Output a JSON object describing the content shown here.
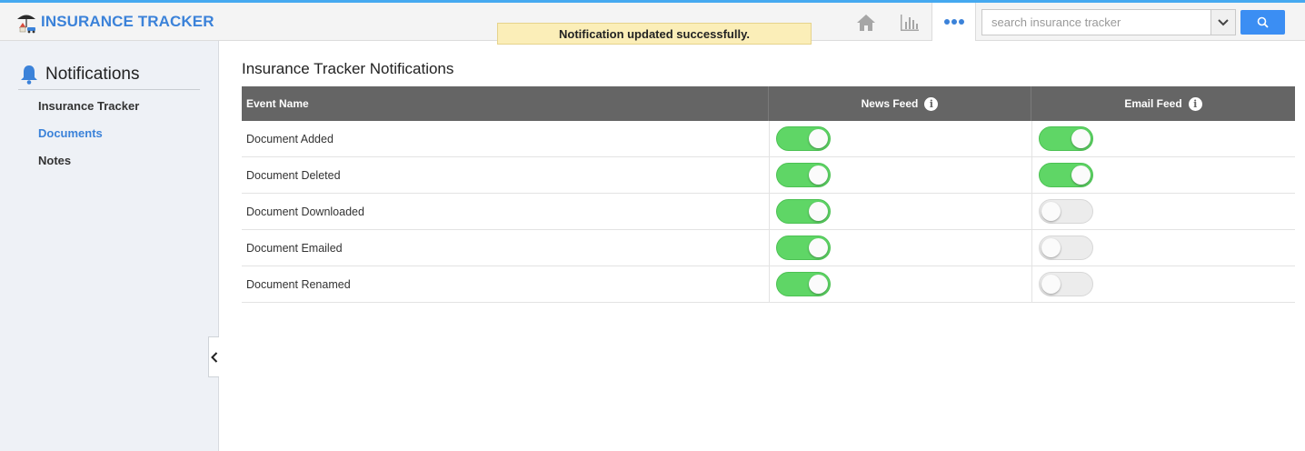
{
  "app": {
    "title": "INSURANCE TRACKER",
    "accent_color": "#3b82d9"
  },
  "toast": {
    "message": "Notification updated successfully."
  },
  "topnav": {
    "icons": [
      "home-icon",
      "bar-chart-icon",
      "more-dots-icon"
    ],
    "search_placeholder": "search insurance tracker"
  },
  "sidebar": {
    "heading": "Notifications",
    "items": [
      {
        "label": "Insurance Tracker",
        "active": false
      },
      {
        "label": "Documents",
        "active": true
      },
      {
        "label": "Notes",
        "active": false
      }
    ]
  },
  "main": {
    "title": "Insurance Tracker Notifications",
    "columns": [
      "Event Name",
      "News Feed",
      "Email Feed"
    ],
    "rows": [
      {
        "event": "Document Added",
        "news_feed": true,
        "email_feed": true
      },
      {
        "event": "Document Deleted",
        "news_feed": true,
        "email_feed": true
      },
      {
        "event": "Document Downloaded",
        "news_feed": true,
        "email_feed": false
      },
      {
        "event": "Document Emailed",
        "news_feed": true,
        "email_feed": false
      },
      {
        "event": "Document Renamed",
        "news_feed": true,
        "email_feed": false
      }
    ]
  }
}
